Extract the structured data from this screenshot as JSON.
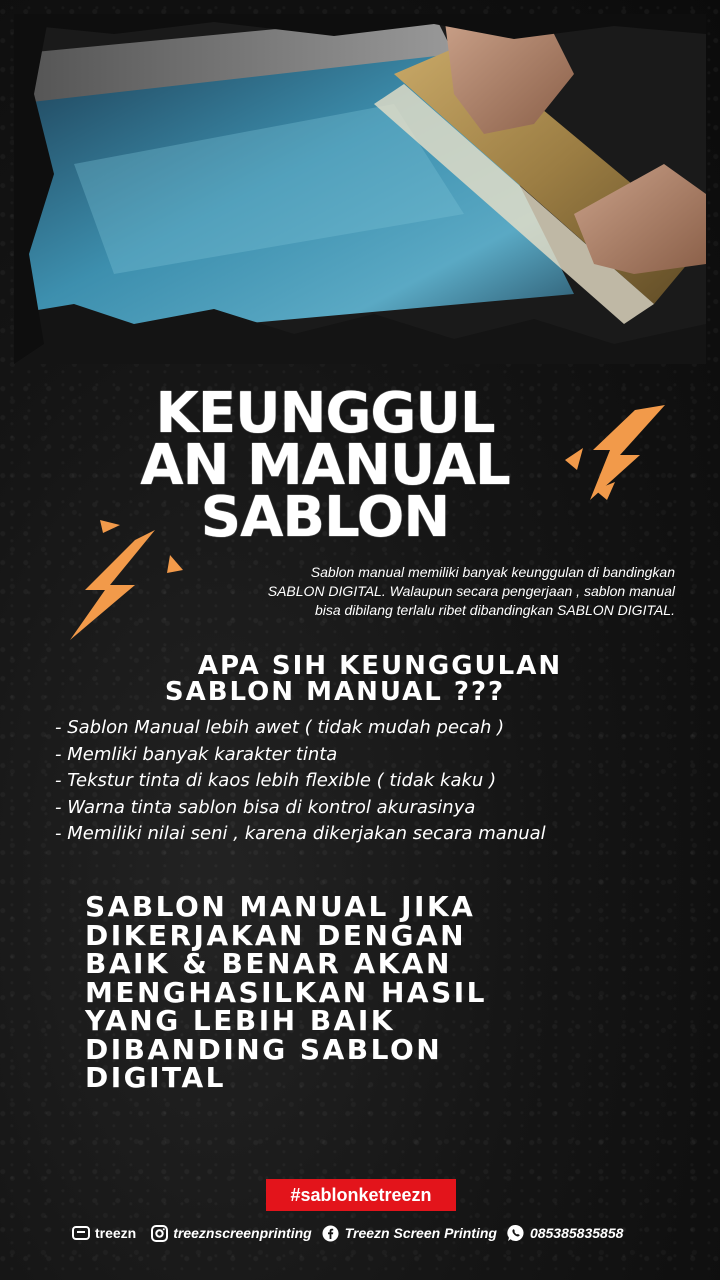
{
  "title": {
    "line1": "KEUNGGUL",
    "line2": "AN MANUAL",
    "line3": "SABLON"
  },
  "intro": {
    "line1": "Sablon manual memiliki banyak keunggulan di bandingkan",
    "line2": "SABLON DIGITAL. Walaupun secara pengerjaan , sablon manual",
    "line3": "bisa dibilang terlalu ribet dibandingkan SABLON DIGITAL."
  },
  "question": {
    "line1": "APA SIH KEUNGGULAN",
    "line2": "SABLON MANUAL ???"
  },
  "benefits": [
    "- Sablon Manual lebih awet ( tidak mudah pecah )",
    "- Memliki banyak karakter tinta",
    "- Tekstur tinta di kaos lebih flexible ( tidak kaku )",
    "- Warna tinta sablon bisa di kontrol akurasinya",
    "- Memiliki nilai seni , karena dikerjakan secara manual"
  ],
  "closing": [
    "SABLON MANUAL JIKA",
    "DIKERJAKAN DENGAN",
    "BAIK & BENAR AKAN",
    "MENGHASILKAN HASIL",
    "YANG LEBIH BAIK",
    "DIBANDING SABLON",
    "DIGITAL"
  ],
  "hashtag": "#sablonketreezn",
  "footer": {
    "brand": "treezn",
    "instagram": "treeznscreenprinting",
    "facebook": "Treezn Screen Printing",
    "whatsapp": "085385835858"
  },
  "colors": {
    "background": "#111111",
    "accent_orange": "#f29a4a",
    "hashtag_red": "#e3141b",
    "ink_blue": "#3d8fae"
  },
  "icons": [
    "lightning-icon",
    "instagram-icon",
    "facebook-icon",
    "whatsapp-icon",
    "treezn-logo-icon"
  ]
}
